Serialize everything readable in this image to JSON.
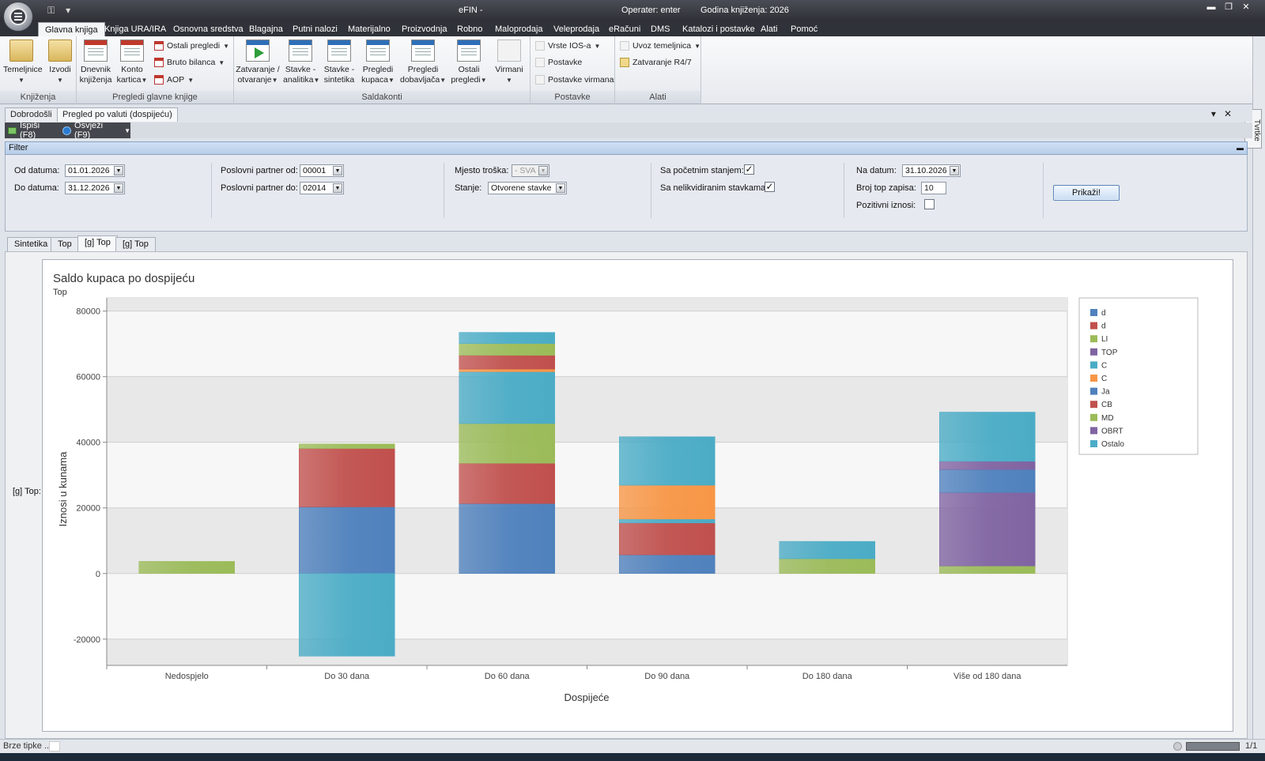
{
  "window": {
    "title": "eFIN -",
    "operater": "Operater: enter",
    "godina": "Godina knjiženja: 2026",
    "qat_icons": [
      "key-icon",
      "customize-arrow-icon"
    ]
  },
  "ribbon_tabs": [
    "Glavna knjiga",
    "Knjiga URA/IRA",
    "Osnovna sredstva",
    "Blagajna",
    "Putni nalozi",
    "Materijalno",
    "Proizvodnja",
    "Robno",
    "Maloprodaja",
    "Veleprodaja",
    "eRačuni",
    "DMS",
    "Katalozi i postavke",
    "Alati",
    "Pomoć"
  ],
  "ribbon": {
    "groups": {
      "knjizenja": "Knjiženja",
      "pregledi": "Pregledi glavne knjige",
      "saldakonti": "Saldakonti",
      "postavke": "Postavke",
      "alati": "Alati"
    },
    "buttons": {
      "temeljnice": "Temeljnice",
      "izvodi": "Izvodi",
      "dnevnik_1": "Dnevnik",
      "dnevnik_2": "knjiženja",
      "konto_1": "Konto",
      "konto_2": "kartica",
      "ostali_pregledi": "Ostali pregledi",
      "bruto_bilanca": "Bruto bilanca",
      "aop": "AOP",
      "zatvaranje_1": "Zatvaranje /",
      "zatvaranje_2": "otvaranje",
      "stavke_analitika_1": "Stavke -",
      "stavke_analitika_2": "analitika",
      "stavke_sintetika_1": "Stavke -",
      "stavke_sintetika_2": "sintetika",
      "pregledi_kupaca_1": "Pregledi",
      "pregledi_kupaca_2": "kupaca",
      "pregledi_dob_1": "Pregledi",
      "pregledi_dob_2": "dobavljača",
      "ostali_pregledi2_1": "Ostali",
      "ostali_pregledi2_2": "pregledi",
      "virmani": "Virmani",
      "vrste_ios": "Vrste IOS-a",
      "postavke": "Postavke",
      "postavke_virmana": "Postavke virmana",
      "uvoz_temeljnica": "Uvoz temeljnica",
      "zatvaranje_r47": "Zatvaranje R4/7"
    }
  },
  "side_tab": "Tvrtke",
  "doc_tabs": [
    "Dobrodošli",
    "Pregled po valuti (dospijeću)"
  ],
  "toolbar": {
    "print": "Ispiši (F8)",
    "refresh": "Osvježi (F9)"
  },
  "filter": {
    "header": "Filter",
    "od_datuma_label": "Od datuma:",
    "od_datuma": "01.01.2026",
    "do_datuma_label": "Do datuma:",
    "do_datuma": "31.12.2026",
    "partner_od_label": "Poslovni partner od:",
    "partner_od": "00001",
    "partner_do_label": "Poslovni partner do:",
    "partner_do": "02014",
    "mjesto_label": "Mjesto troška:",
    "mjesto": "- SVA -",
    "stanje_label": "Stanje:",
    "stanje": "Otvorene stavke",
    "pocetno_label": "Sa početnim stanjem:",
    "pocetno": true,
    "nelikvidirano_label": "Sa nelikvidiranim stavkama:",
    "nelikvidirano": true,
    "na_datum_label": "Na datum:",
    "na_datum": "31.10.2026",
    "broj_top_label": "Broj top zapisa:",
    "broj_top": "10",
    "pozitivni_label": "Pozitivni iznosi:",
    "pozitivni": false,
    "prikazi": "Prikaži!"
  },
  "inner_tabs": [
    "Sintetika",
    "Top",
    "[g] Top",
    "[g] Top"
  ],
  "side_label": "[g] Top:",
  "status": {
    "brze_tipke": "Brze tipke ...",
    "page": "1/1"
  },
  "chart_data": {
    "type": "bar",
    "stacked": true,
    "title": "Saldo kupaca po dospijeću",
    "subtitle": "Top",
    "xlabel": "Dospijeće",
    "ylabel": "Iznosi u kunama",
    "ylim": [
      -28000,
      84000
    ],
    "yticks": [
      -20000,
      0,
      20000,
      40000,
      60000,
      80000
    ],
    "legend_position": "right",
    "categories": [
      "Nedospjelo",
      "Do 30 dana",
      "Do 60 dana",
      "Do 90 dana",
      "Do 180 dana",
      "Više od 180 dana"
    ],
    "series": [
      {
        "name": "d",
        "color": "#4f81bd",
        "values": [
          0,
          20300,
          21300,
          5700,
          0,
          0
        ]
      },
      {
        "name": "d",
        "color": "#c0504d",
        "values": [
          0,
          17800,
          12300,
          9700,
          0,
          0
        ]
      },
      {
        "name": "LI",
        "color": "#9bbb59",
        "values": [
          3700,
          1400,
          12100,
          0,
          4500,
          2300
        ]
      },
      {
        "name": "TOP",
        "color": "#8064a2",
        "values": [
          0,
          0,
          0,
          0,
          0,
          22400
        ]
      },
      {
        "name": "C",
        "color": "#4bacc6",
        "values": [
          0,
          0,
          15800,
          1200,
          0,
          0
        ]
      },
      {
        "name": "C",
        "color": "#f79646",
        "values": [
          0,
          0,
          800,
          10300,
          0,
          0
        ]
      },
      {
        "name": "Ja",
        "color": "#4f81bd",
        "values": [
          0,
          0,
          0,
          0,
          0,
          7000
        ]
      },
      {
        "name": "CB",
        "color": "#c0504d",
        "values": [
          0,
          0,
          4200,
          0,
          0,
          0
        ]
      },
      {
        "name": "MD",
        "color": "#9bbb59",
        "values": [
          0,
          0,
          3600,
          0,
          0,
          0
        ]
      },
      {
        "name": "OBRT",
        "color": "#8064a2",
        "values": [
          0,
          0,
          0,
          0,
          0,
          2500
        ]
      },
      {
        "name": "Ostalo",
        "color": "#4bacc6",
        "values": [
          0,
          -25200,
          3400,
          14800,
          5300,
          15000
        ]
      }
    ]
  }
}
